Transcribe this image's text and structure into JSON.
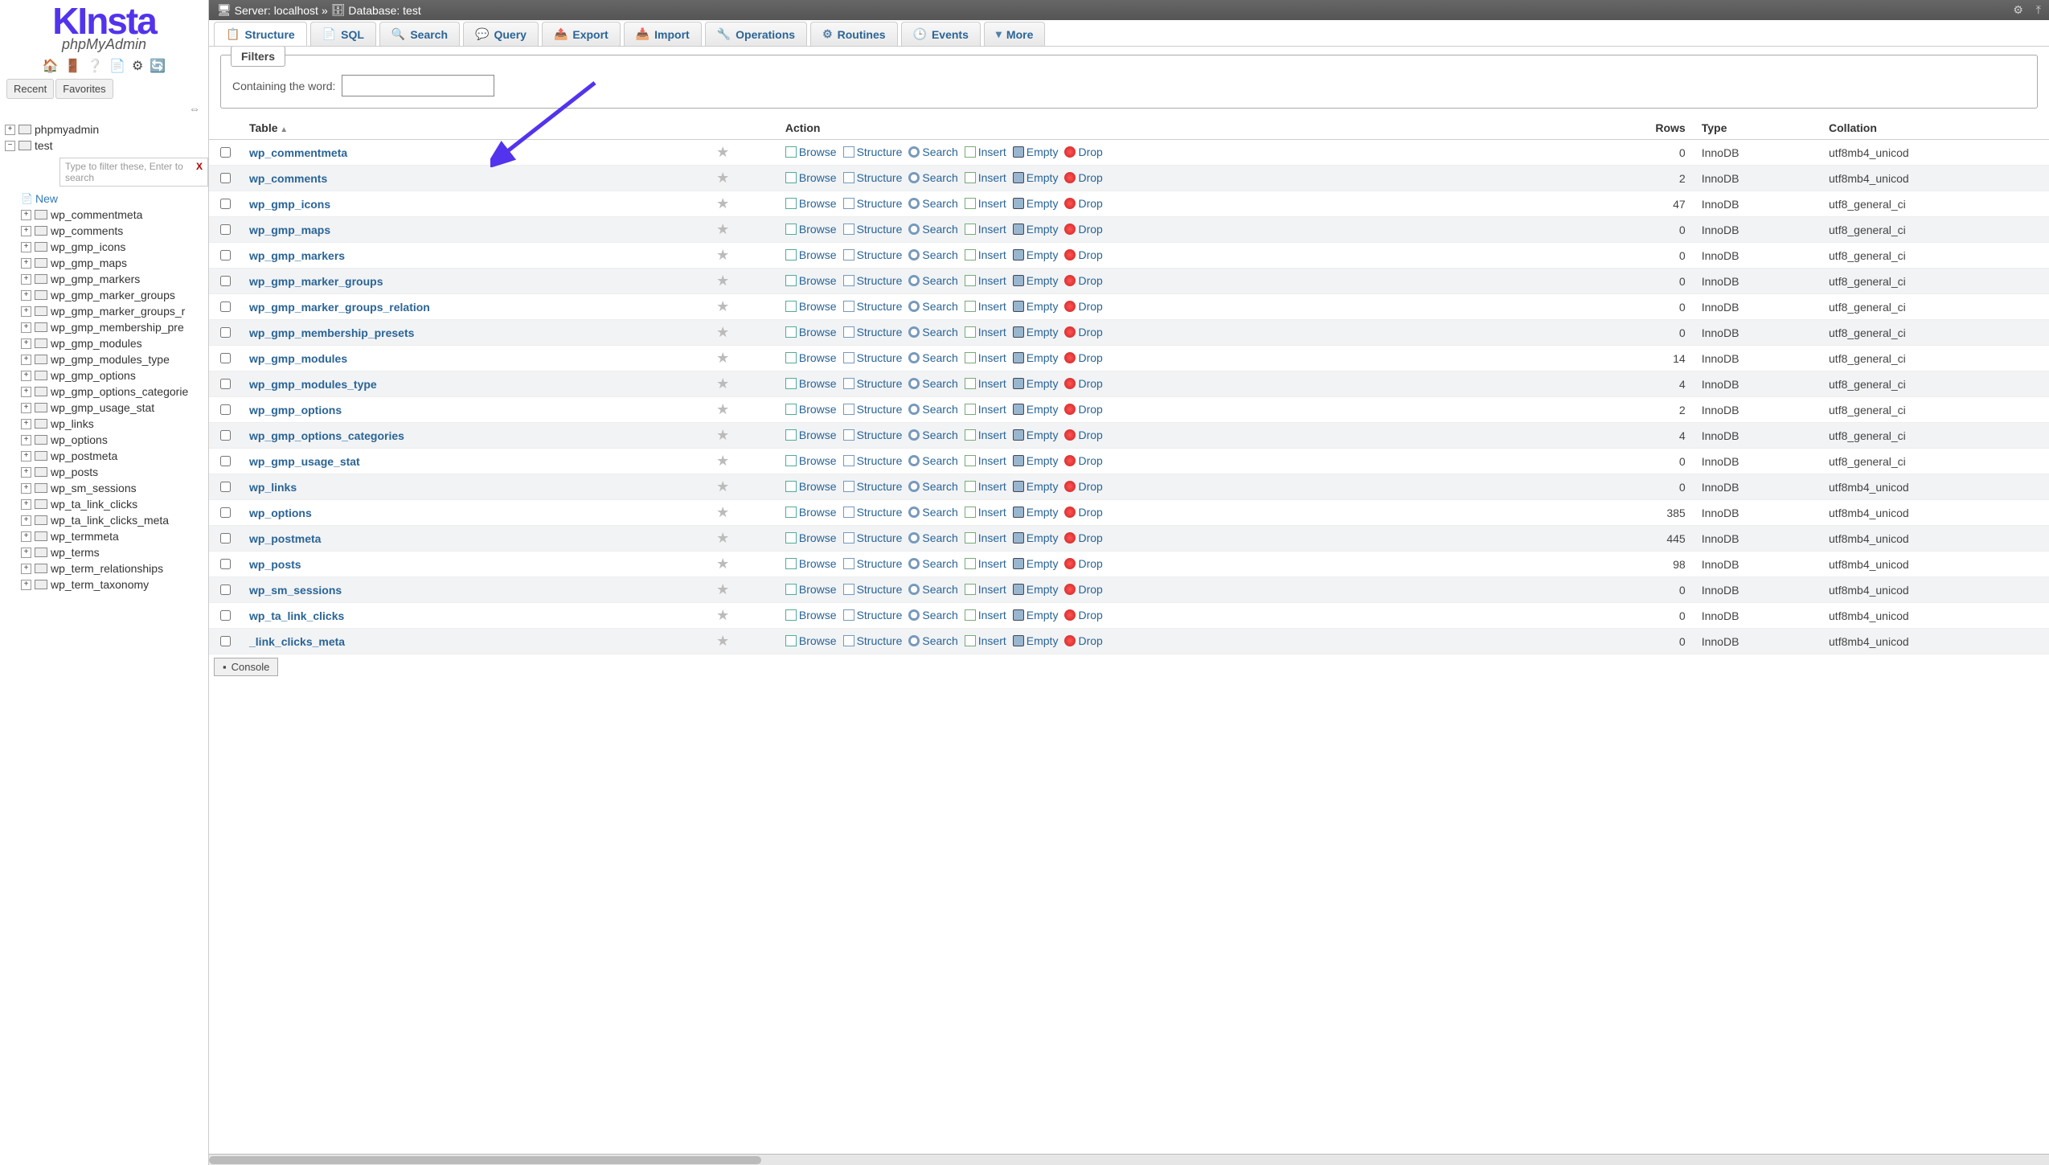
{
  "logo": {
    "brand": "KInsta",
    "sub": "phpMyAdmin"
  },
  "side_tabs": {
    "recent": "Recent",
    "favorites": "Favorites"
  },
  "filter_placeholder": "Type to filter these, Enter to search",
  "tree_root": "phpmyadmin",
  "tree_db": "test",
  "tree_new": "New",
  "tree_tables": [
    "wp_commentmeta",
    "wp_comments",
    "wp_gmp_icons",
    "wp_gmp_maps",
    "wp_gmp_markers",
    "wp_gmp_marker_groups",
    "wp_gmp_marker_groups_r",
    "wp_gmp_membership_pre",
    "wp_gmp_modules",
    "wp_gmp_modules_type",
    "wp_gmp_options",
    "wp_gmp_options_categorie",
    "wp_gmp_usage_stat",
    "wp_links",
    "wp_options",
    "wp_postmeta",
    "wp_posts",
    "wp_sm_sessions",
    "wp_ta_link_clicks",
    "wp_ta_link_clicks_meta",
    "wp_termmeta",
    "wp_terms",
    "wp_term_relationships",
    "wp_term_taxonomy"
  ],
  "topbar": {
    "server_label": "Server:",
    "server": "localhost",
    "db_label": "Database:",
    "db": "test"
  },
  "tabs": [
    {
      "icon": "📋",
      "label": "Structure"
    },
    {
      "icon": "📄",
      "label": "SQL"
    },
    {
      "icon": "🔍",
      "label": "Search"
    },
    {
      "icon": "💬",
      "label": "Query"
    },
    {
      "icon": "📤",
      "label": "Export"
    },
    {
      "icon": "📥",
      "label": "Import"
    },
    {
      "icon": "🔧",
      "label": "Operations"
    },
    {
      "icon": "⚙",
      "label": "Routines"
    },
    {
      "icon": "🕒",
      "label": "Events"
    },
    {
      "icon": "▾",
      "label": "More"
    }
  ],
  "filters": {
    "legend": "Filters",
    "containing": "Containing the word:"
  },
  "columns": {
    "table": "Table",
    "action": "Action",
    "rows": "Rows",
    "type": "Type",
    "collation": "Collation"
  },
  "actions": {
    "browse": "Browse",
    "structure": "Structure",
    "search": "Search",
    "insert": "Insert",
    "empty": "Empty",
    "drop": "Drop"
  },
  "console": "Console",
  "tables": [
    {
      "name": "wp_commentmeta",
      "rows": 0,
      "type": "InnoDB",
      "collation": "utf8mb4_unicod"
    },
    {
      "name": "wp_comments",
      "rows": 2,
      "type": "InnoDB",
      "collation": "utf8mb4_unicod"
    },
    {
      "name": "wp_gmp_icons",
      "rows": 47,
      "type": "InnoDB",
      "collation": "utf8_general_ci"
    },
    {
      "name": "wp_gmp_maps",
      "rows": 0,
      "type": "InnoDB",
      "collation": "utf8_general_ci"
    },
    {
      "name": "wp_gmp_markers",
      "rows": 0,
      "type": "InnoDB",
      "collation": "utf8_general_ci"
    },
    {
      "name": "wp_gmp_marker_groups",
      "rows": 0,
      "type": "InnoDB",
      "collation": "utf8_general_ci"
    },
    {
      "name": "wp_gmp_marker_groups_relation",
      "rows": 0,
      "type": "InnoDB",
      "collation": "utf8_general_ci"
    },
    {
      "name": "wp_gmp_membership_presets",
      "rows": 0,
      "type": "InnoDB",
      "collation": "utf8_general_ci"
    },
    {
      "name": "wp_gmp_modules",
      "rows": 14,
      "type": "InnoDB",
      "collation": "utf8_general_ci"
    },
    {
      "name": "wp_gmp_modules_type",
      "rows": 4,
      "type": "InnoDB",
      "collation": "utf8_general_ci"
    },
    {
      "name": "wp_gmp_options",
      "rows": 2,
      "type": "InnoDB",
      "collation": "utf8_general_ci"
    },
    {
      "name": "wp_gmp_options_categories",
      "rows": 4,
      "type": "InnoDB",
      "collation": "utf8_general_ci"
    },
    {
      "name": "wp_gmp_usage_stat",
      "rows": 0,
      "type": "InnoDB",
      "collation": "utf8_general_ci"
    },
    {
      "name": "wp_links",
      "rows": 0,
      "type": "InnoDB",
      "collation": "utf8mb4_unicod"
    },
    {
      "name": "wp_options",
      "rows": 385,
      "type": "InnoDB",
      "collation": "utf8mb4_unicod"
    },
    {
      "name": "wp_postmeta",
      "rows": 445,
      "type": "InnoDB",
      "collation": "utf8mb4_unicod"
    },
    {
      "name": "wp_posts",
      "rows": 98,
      "type": "InnoDB",
      "collation": "utf8mb4_unicod"
    },
    {
      "name": "wp_sm_sessions",
      "rows": 0,
      "type": "InnoDB",
      "collation": "utf8mb4_unicod"
    },
    {
      "name": "wp_ta_link_clicks",
      "rows": 0,
      "type": "InnoDB",
      "collation": "utf8mb4_unicod"
    },
    {
      "name": "_link_clicks_meta",
      "rows": 0,
      "type": "InnoDB",
      "collation": "utf8mb4_unicod"
    }
  ]
}
